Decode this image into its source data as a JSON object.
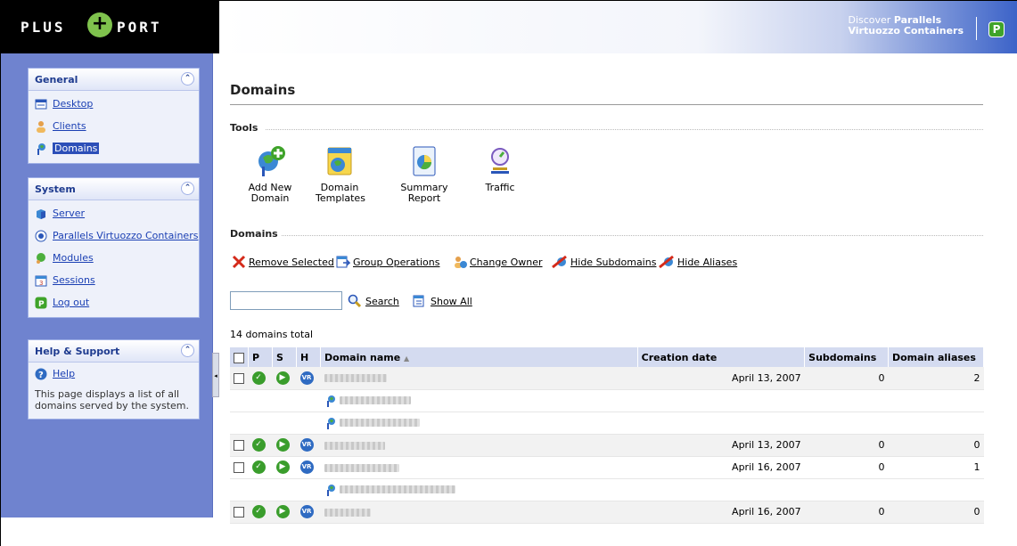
{
  "logo": {
    "left": "PLUS",
    "symbol": "+",
    "right": "PORT"
  },
  "promo": {
    "line1_prefix": "Discover ",
    "line1_strong": "Parallels",
    "line2": "Virtuozzo Containers"
  },
  "sidebar": {
    "general": {
      "title": "General",
      "items": [
        {
          "label": "Desktop",
          "icon": "desktop-icon"
        },
        {
          "label": "Clients",
          "icon": "clients-icon"
        },
        {
          "label": "Domains",
          "icon": "domains-icon"
        }
      ]
    },
    "system": {
      "title": "System",
      "items": [
        {
          "label": "Server",
          "icon": "server-icon"
        },
        {
          "label": "Parallels Virtuozzo Containers",
          "icon": "virtuozzo-icon"
        },
        {
          "label": "Modules",
          "icon": "modules-icon"
        },
        {
          "label": "Sessions",
          "icon": "sessions-icon"
        },
        {
          "label": "Log out",
          "icon": "logout-icon"
        }
      ]
    },
    "help": {
      "title": "Help & Support",
      "help_label": "Help",
      "description": "This page displays a list of all domains served by the system."
    }
  },
  "main": {
    "title": "Domains",
    "tools_label": "Tools",
    "tools": [
      {
        "label": "Add New Domain",
        "icon": "add-domain-icon"
      },
      {
        "label": "Domain\nTemplates",
        "icon": "domain-templates-icon"
      },
      {
        "label": "Summary Report",
        "icon": "summary-report-icon"
      },
      {
        "label": "Traffic",
        "icon": "traffic-icon"
      }
    ],
    "domains_label": "Domains",
    "actions": {
      "remove": "Remove Selected",
      "group": "Group Operations",
      "owner": "Change Owner",
      "hide_sub": "Hide Subdomains",
      "hide_alias": "Hide Aliases"
    },
    "search_value": "",
    "search_label": "Search",
    "show_all_label": "Show All",
    "total": "14 domains total",
    "columns": {
      "p": "P",
      "s": "S",
      "h": "H",
      "name": "Domain name",
      "sort_icon": "▲",
      "created": "Creation date",
      "subdomains": "Subdomains",
      "aliases": "Domain aliases"
    },
    "rows": [
      {
        "type": "domain",
        "created": "April 13, 2007",
        "subdomains": "0",
        "aliases": "2"
      },
      {
        "type": "sub"
      },
      {
        "type": "sub"
      },
      {
        "type": "domain",
        "created": "April 13, 2007",
        "subdomains": "0",
        "aliases": "0"
      },
      {
        "type": "domain",
        "created": "April 16, 2007",
        "subdomains": "0",
        "aliases": "1"
      },
      {
        "type": "sub"
      },
      {
        "type": "domain",
        "created": "April 16, 2007",
        "subdomains": "0",
        "aliases": "0"
      }
    ]
  },
  "colors": {
    "sidebar": "#6f83cf",
    "header_bg": "#d4dbf0",
    "link": "#1a3fb3"
  }
}
